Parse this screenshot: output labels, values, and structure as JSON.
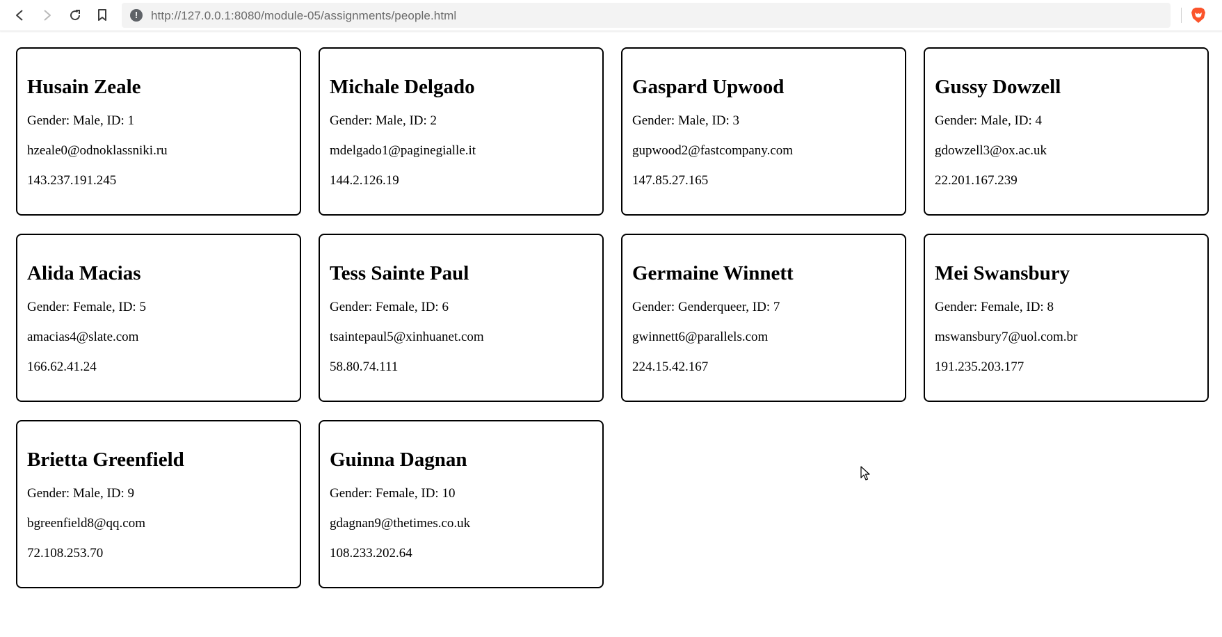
{
  "browser": {
    "url": "http://127.0.0.1:8080/module-05/assignments/people.html",
    "icons": {
      "back": "back-arrow-icon",
      "forward": "forward-arrow-icon",
      "reload": "reload-icon",
      "bookmark": "bookmark-icon",
      "site_info": "info-icon",
      "brave": "brave-lion-icon"
    },
    "info_glyph": "!"
  },
  "people": [
    {
      "name": "Husain Zeale",
      "gender_line": "Gender: Male, ID: 1",
      "email": "hzeale0@odnoklassniki.ru",
      "ip": "143.237.191.245"
    },
    {
      "name": "Michale Delgado",
      "gender_line": "Gender: Male, ID: 2",
      "email": "mdelgado1@paginegialle.it",
      "ip": "144.2.126.19"
    },
    {
      "name": "Gaspard Upwood",
      "gender_line": "Gender: Male, ID: 3",
      "email": "gupwood2@fastcompany.com",
      "ip": "147.85.27.165"
    },
    {
      "name": "Gussy Dowzell",
      "gender_line": "Gender: Male, ID: 4",
      "email": "gdowzell3@ox.ac.uk",
      "ip": "22.201.167.239"
    },
    {
      "name": "Alida Macias",
      "gender_line": "Gender: Female, ID: 5",
      "email": "amacias4@slate.com",
      "ip": "166.62.41.24"
    },
    {
      "name": "Tess Sainte Paul",
      "gender_line": "Gender: Female, ID: 6",
      "email": "tsaintepaul5@xinhuanet.com",
      "ip": "58.80.74.111"
    },
    {
      "name": "Germaine Winnett",
      "gender_line": "Gender: Genderqueer, ID: 7",
      "email": "gwinnett6@parallels.com",
      "ip": "224.15.42.167"
    },
    {
      "name": "Mei Swansbury",
      "gender_line": "Gender: Female, ID: 8",
      "email": "mswansbury7@uol.com.br",
      "ip": "191.235.203.177"
    },
    {
      "name": "Brietta Greenfield",
      "gender_line": "Gender: Male, ID: 9",
      "email": "bgreenfield8@qq.com",
      "ip": "72.108.253.70"
    },
    {
      "name": "Guinna Dagnan",
      "gender_line": "Gender: Female, ID: 10",
      "email": "gdagnan9@thetimes.co.uk",
      "ip": "108.233.202.64"
    }
  ],
  "colors": {
    "card_border": "#000000",
    "brave_orange": "#fb542b"
  }
}
